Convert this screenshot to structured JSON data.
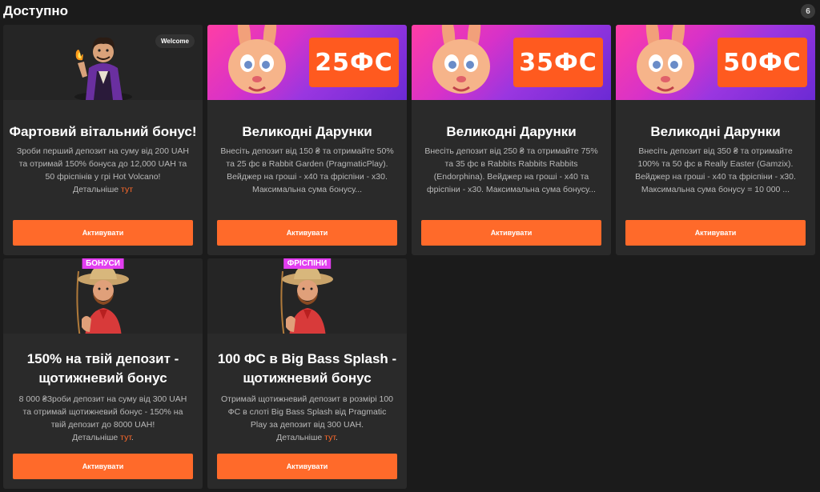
{
  "header": {
    "title": "Доступно",
    "count": "6"
  },
  "button_label": "Активувати",
  "cards": [
    {
      "welcome_tag": "Welcome",
      "title": "Фартовий вітальний бонус!",
      "desc": "Зроби перший депозит на суму від 200 UAH та отримай 150% бонуса до 12,000 UAH та 50 фріспінів у грі Hot Volcano!",
      "more_prefix": "Детальніше ",
      "more_link": "тут",
      "more_suffix": ""
    },
    {
      "badge": "25ФС",
      "title": "Великодні Дарунки",
      "desc": "Внесіть депозит від 150 ₴ та отримайте 50% та 25 фс в Rabbit Garden (PragmaticPlay). Вейджер на гроші - х40 та фріспіни - х30. Максимальна сума бонусу..."
    },
    {
      "badge": "35ФС",
      "title": "Великодні Дарунки",
      "desc": "Внесіть депозит від 250 ₴ та отримайте 75% та 35 фс в Rabbits Rabbits Rabbits (Endorphina). Вейджер на гроші - х40 та фріспіни - х30. Максимальна сума бонусу..."
    },
    {
      "badge": "50ФС",
      "title": "Великодні Дарунки",
      "desc": "Внесіть депозит від 350 ₴ та отримайте 100% та 50 фс в Really Easter (Gamzix). Вейджер на гроші - х40 та фріспіни - х30. Максимальна сума бонусу = 10 000 ..."
    },
    {
      "tag": "БОНУСИ",
      "title": "150% на твій депозит - щотижневий бонус",
      "desc": "8 000 ₴Зроби депозит на суму від 300 UAH та отримай щотижневий бонус - 150% на твій депозит до 8000 UAH!",
      "more_prefix": "Детальніше ",
      "more_link": "тут",
      "more_suffix": "."
    },
    {
      "tag": "ФРІСПІНИ",
      "title": "100 ФС в Big Bass Splash - щотижневий бонус",
      "desc": "Отримай щотижневий депозит в розмірі 100 ФС в слоті Big Bass Splash від Pragmatic Play за депозит від 300 UAH.",
      "more_prefix": "Детальніше ",
      "more_link": "тут",
      "more_suffix": "."
    }
  ],
  "colors": {
    "accent": "#ff6a2a",
    "card": "#2a2a2a",
    "background": "#1b1b1b",
    "pink_tag": "#e23df0"
  }
}
